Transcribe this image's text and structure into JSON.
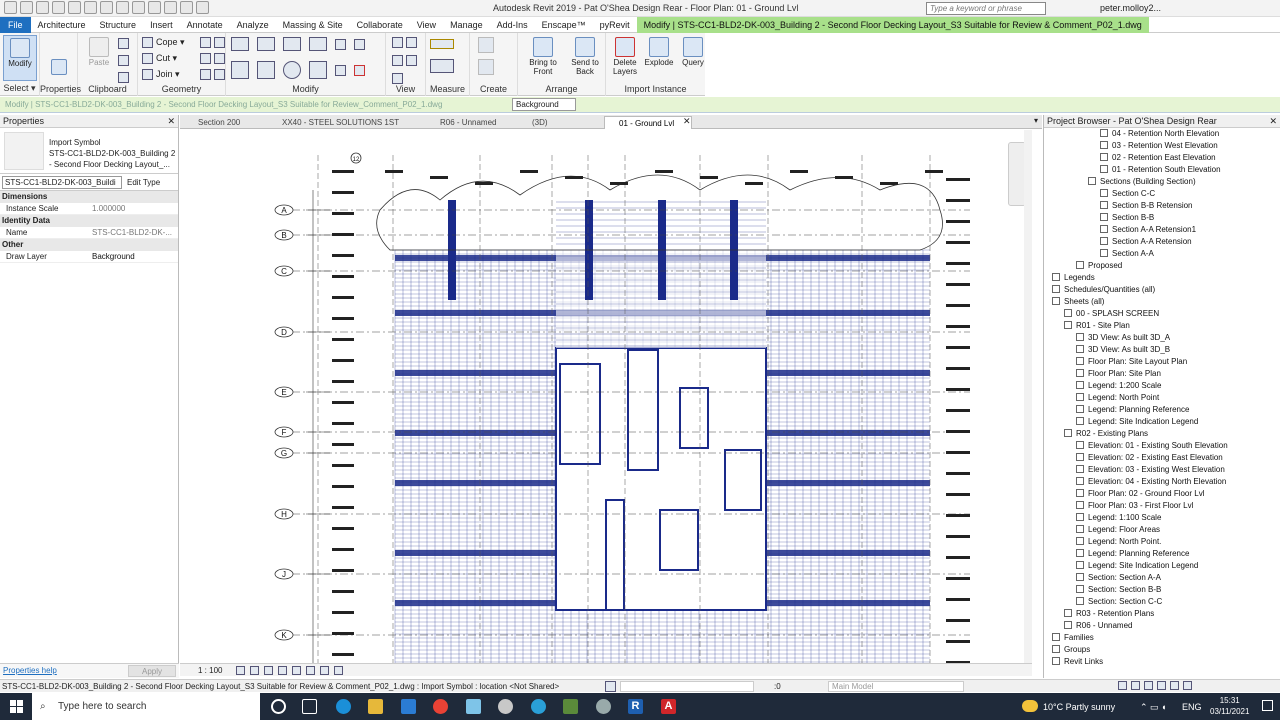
{
  "window": {
    "title": "Autodesk Revit 2019 - Pat O'Shea Design Rear - Floor Plan: 01 - Ground Lvl",
    "search_placeholder": "Type a keyword or phrase",
    "user": "peter.molloy2..."
  },
  "menu": {
    "tabs": [
      "File",
      "Architecture",
      "Structure",
      "Insert",
      "Annotate",
      "Analyze",
      "Massing & Site",
      "Collaborate",
      "View",
      "Manage",
      "Add-Ins",
      "Enscape™",
      "pyRevit",
      "Modify | STS-CC1-BLD2-DK-003_Building 2 - Second Floor Decking Layout_S3 Suitable for Review & Comment_P02_1.dwg"
    ]
  },
  "ribbon": {
    "modify": "Modify",
    "select": "Select ▾",
    "properties": "Properties",
    "paste": "Paste",
    "clipboard": "Clipboard",
    "geometry": "Geometry",
    "cope": "Cope ▾",
    "cut": "Cut ▾",
    "join": "Join ▾",
    "modify_group": "Modify",
    "view": "View",
    "measure": "Measure",
    "create": "Create",
    "bring_to_front": "Bring to Front",
    "send_to_back": "Send to Back",
    "delete_layers": "Delete Layers",
    "explode": "Explode",
    "query": "Query",
    "arrange": "Arrange",
    "import_instance": "Import Instance"
  },
  "context_bar": {
    "text": "Modify | STS-CC1-BLD2-DK-003_Building 2 - Second Floor Decking Layout_S3 Suitable for Review_Comment_P02_1.dwg",
    "draw_layer_value": "Background"
  },
  "properties": {
    "header": "Properties",
    "type_line1": "Import Symbol",
    "type_line2": "STS-CC1-BLD2-DK-003_Building 2",
    "type_line3": "- Second Floor Decking Layout_...",
    "selector": "STS-CC1-BLD2-DK-003_Buildi",
    "edit_type": "Edit Type",
    "dimensions": "Dimensions",
    "instance_scale_label": "Instance Scale",
    "instance_scale_value": "1.000000",
    "identity": "Identity Data",
    "name_label": "Name",
    "name_value": "STS-CC1-BLD2-DK-...",
    "other": "Other",
    "draw_layer_label": "Draw Layer",
    "draw_layer_value": "Background",
    "help": "Properties help",
    "apply": "Apply"
  },
  "view_tabs": [
    "Section 200",
    "XX40 - STEEL SOLUTIONS 1ST FLO...",
    "R06 - Unnamed",
    "(3D)",
    "01 - Ground Lvl"
  ],
  "grid_labels": [
    "A",
    "B",
    "C",
    "D",
    "E",
    "F",
    "G",
    "H",
    "J",
    "K"
  ],
  "grid_top_label": "12",
  "view_control": {
    "scale": "1 : 100"
  },
  "browser": {
    "header": "Project Browser - Pat O'Shea Design Rear",
    "nodes": [
      {
        "t": "04 - Retention North Elevation",
        "d": 4
      },
      {
        "t": "03 - Retention West Elevation",
        "d": 4
      },
      {
        "t": "02 - Retention East Elevation",
        "d": 4
      },
      {
        "t": "01 - Retention South Elevation",
        "d": 4
      },
      {
        "t": "Sections (Building Section)",
        "d": 3
      },
      {
        "t": "Section C-C",
        "d": 4
      },
      {
        "t": "Section B-B Retension",
        "d": 4
      },
      {
        "t": "Section B-B",
        "d": 4
      },
      {
        "t": "Section A-A Retension1",
        "d": 4
      },
      {
        "t": "Section A-A Retension",
        "d": 4
      },
      {
        "t": "Section A-A",
        "d": 4
      },
      {
        "t": "Proposed",
        "d": 2
      },
      {
        "t": "Legends",
        "d": 0
      },
      {
        "t": "Schedules/Quantities (all)",
        "d": 0
      },
      {
        "t": "Sheets (all)",
        "d": 0
      },
      {
        "t": "00 - SPLASH SCREEN",
        "d": 1
      },
      {
        "t": "R01 - Site Plan",
        "d": 1
      },
      {
        "t": "3D View: As built 3D_A",
        "d": 2
      },
      {
        "t": "3D View: As built 3D_B",
        "d": 2
      },
      {
        "t": "Floor Plan: Site Layout Plan",
        "d": 2
      },
      {
        "t": "Floor Plan: Site Plan",
        "d": 2
      },
      {
        "t": "Legend: 1:200 Scale",
        "d": 2
      },
      {
        "t": "Legend: North Point",
        "d": 2
      },
      {
        "t": "Legend: Planning Reference",
        "d": 2
      },
      {
        "t": "Legend: Site Indication Legend",
        "d": 2
      },
      {
        "t": "R02 - Existing Plans",
        "d": 1
      },
      {
        "t": "Elevation: 01 - Existing South Elevation",
        "d": 2
      },
      {
        "t": "Elevation: 02 - Existing East Elevation",
        "d": 2
      },
      {
        "t": "Elevation: 03 - Existing West Elevation",
        "d": 2
      },
      {
        "t": "Elevation: 04 - Existing North Elevation",
        "d": 2
      },
      {
        "t": "Floor Plan: 02 - Ground Floor Lvl",
        "d": 2
      },
      {
        "t": "Floor Plan: 03 - First Floor Lvl",
        "d": 2
      },
      {
        "t": "Legend: 1:100 Scale",
        "d": 2
      },
      {
        "t": "Legend: Floor Areas",
        "d": 2
      },
      {
        "t": "Legend: North Point.",
        "d": 2
      },
      {
        "t": "Legend: Planning Reference",
        "d": 2
      },
      {
        "t": "Legend: Site Indication Legend",
        "d": 2
      },
      {
        "t": "Section: Section A-A",
        "d": 2
      },
      {
        "t": "Section: Section B-B",
        "d": 2
      },
      {
        "t": "Section: Section C-C",
        "d": 2
      },
      {
        "t": "R03 - Retention Plans",
        "d": 1
      },
      {
        "t": "R06 - Unnamed",
        "d": 1
      },
      {
        "t": "Families",
        "d": 0
      },
      {
        "t": "Groups",
        "d": 0
      },
      {
        "t": "Revit Links",
        "d": 0
      }
    ]
  },
  "status": {
    "text": "STS-CC1-BLD2-DK-003_Building 2 - Second Floor Decking Layout_S3 Suitable for Review & Comment_P02_1.dwg : Import Symbol : location <Not Shared>",
    "zero": ":0",
    "model": "Main Model"
  },
  "taskbar": {
    "search": "Type here to search",
    "weather": "10°C  Partly sunny",
    "lang": "ENG",
    "time": "15:31",
    "date": "03/11/2021"
  },
  "colors": {
    "accent": "#1e6fc0",
    "context": "#a8e08a",
    "drawing": "#1a2a8a"
  }
}
